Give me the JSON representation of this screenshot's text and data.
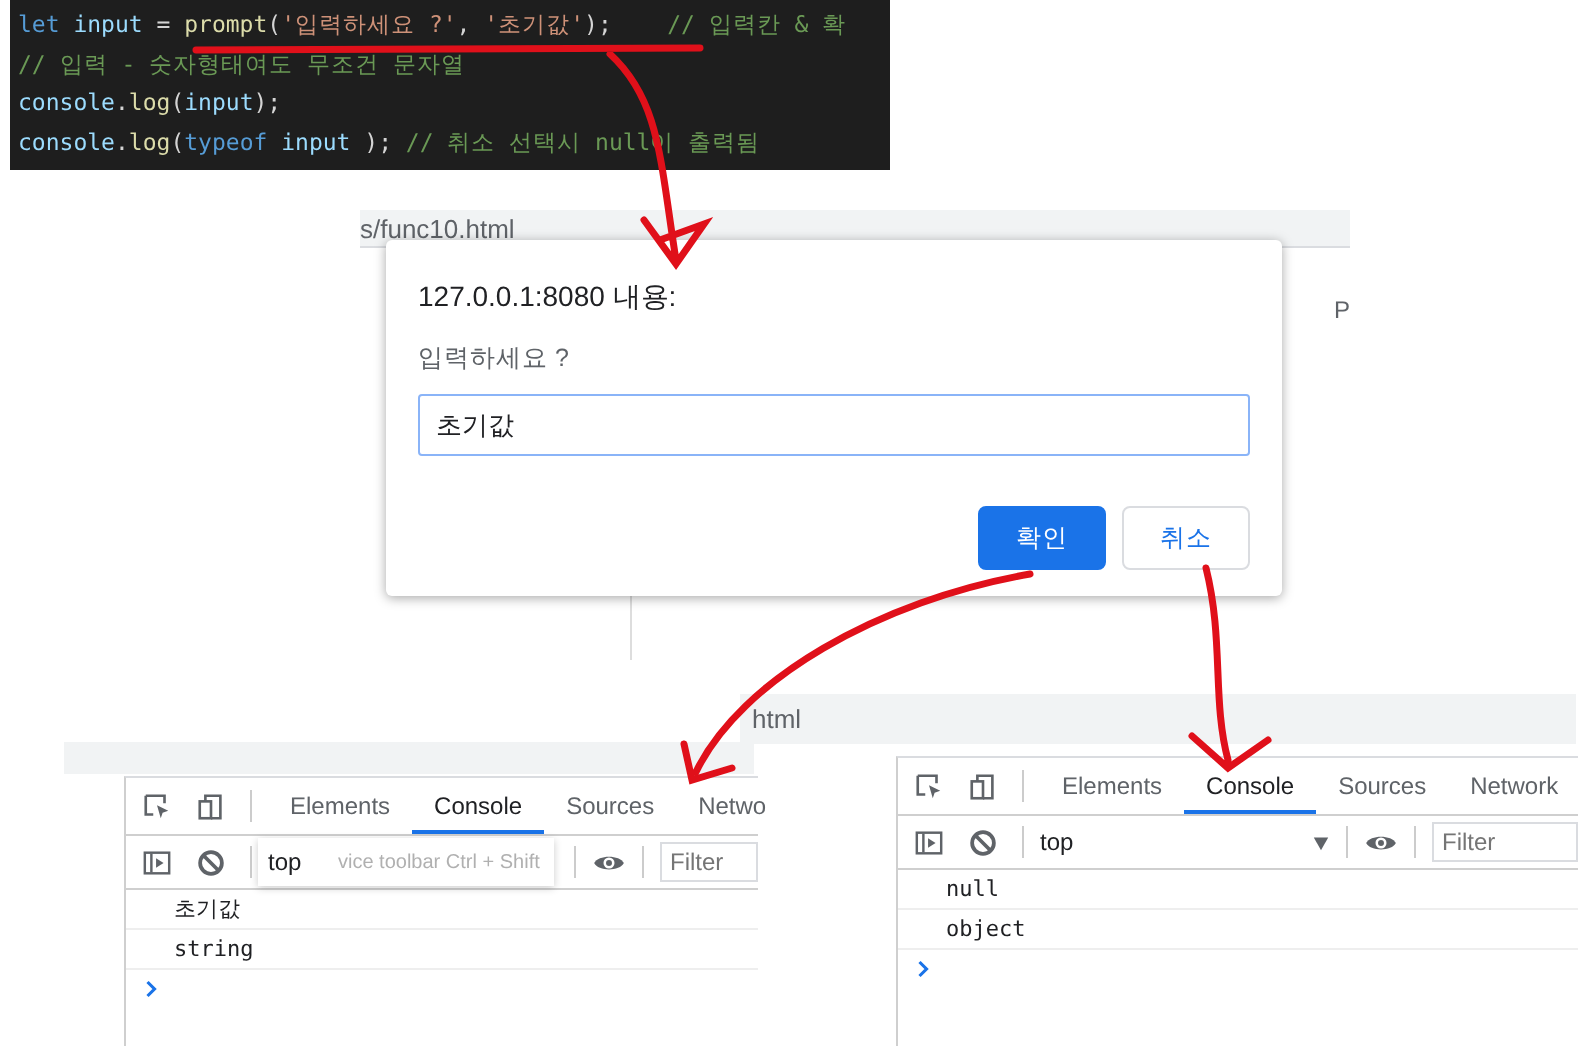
{
  "code_editor": {
    "lines": [
      [
        {
          "kind": "keyword",
          "text": "let "
        },
        {
          "kind": "variable",
          "text": "input"
        },
        {
          "kind": "plain",
          "text": " = "
        },
        {
          "kind": "function",
          "text": "prompt"
        },
        {
          "kind": "plain",
          "text": "("
        },
        {
          "kind": "string",
          "text": "'입력하세요 ?'"
        },
        {
          "kind": "plain",
          "text": ", "
        },
        {
          "kind": "string",
          "text": "'초기값'"
        },
        {
          "kind": "plain",
          "text": ");    "
        },
        {
          "kind": "comment",
          "text": "// 입력칸 & 확"
        }
      ],
      [
        {
          "kind": "comment",
          "text": "// 입력 - 숫자형태여도 무조건 문자열"
        }
      ],
      [
        {
          "kind": "variable",
          "text": "console"
        },
        {
          "kind": "plain",
          "text": "."
        },
        {
          "kind": "function",
          "text": "log"
        },
        {
          "kind": "plain",
          "text": "("
        },
        {
          "kind": "variable",
          "text": "input"
        },
        {
          "kind": "plain",
          "text": ");"
        }
      ],
      [
        {
          "kind": "variable",
          "text": "console"
        },
        {
          "kind": "plain",
          "text": "."
        },
        {
          "kind": "function",
          "text": "log"
        },
        {
          "kind": "plain",
          "text": "("
        },
        {
          "kind": "keyword",
          "text": "typeof "
        },
        {
          "kind": "variable",
          "text": "input"
        },
        {
          "kind": "plain",
          "text": " ); "
        },
        {
          "kind": "comment",
          "text": "// 취소 선택시 null이 출력됨"
        }
      ]
    ]
  },
  "browser": {
    "address_fragment": "s/func10.html",
    "tab_fragment": "P"
  },
  "prompt_dialog": {
    "title": "127.0.0.1:8080 내용:",
    "message": "입력하세요 ?",
    "value": "초기값",
    "buttons": [
      {
        "label": "확인",
        "primary": true
      },
      {
        "label": "취소",
        "primary": false
      }
    ]
  },
  "second_browser": {
    "address_fragment": "html"
  },
  "devtools_panels": [
    {
      "tabs": [
        {
          "label": "Elements",
          "selected": false
        },
        {
          "label": "Console",
          "selected": true
        },
        {
          "label": "Sources",
          "selected": false
        },
        {
          "label": "Netwo",
          "selected": false
        }
      ],
      "context": "top",
      "filter_placeholder": "Filter",
      "tooltip": "vice toolbar Ctrl + Shift",
      "console_lines": [
        "초기값",
        "string"
      ]
    },
    {
      "tabs": [
        {
          "label": "Elements",
          "selected": false
        },
        {
          "label": "Console",
          "selected": true
        },
        {
          "label": "Sources",
          "selected": false
        },
        {
          "label": "Network",
          "selected": false
        }
      ],
      "context": "top",
      "filter_placeholder": "Filter",
      "console_lines": [
        "null",
        "object"
      ]
    }
  ]
}
